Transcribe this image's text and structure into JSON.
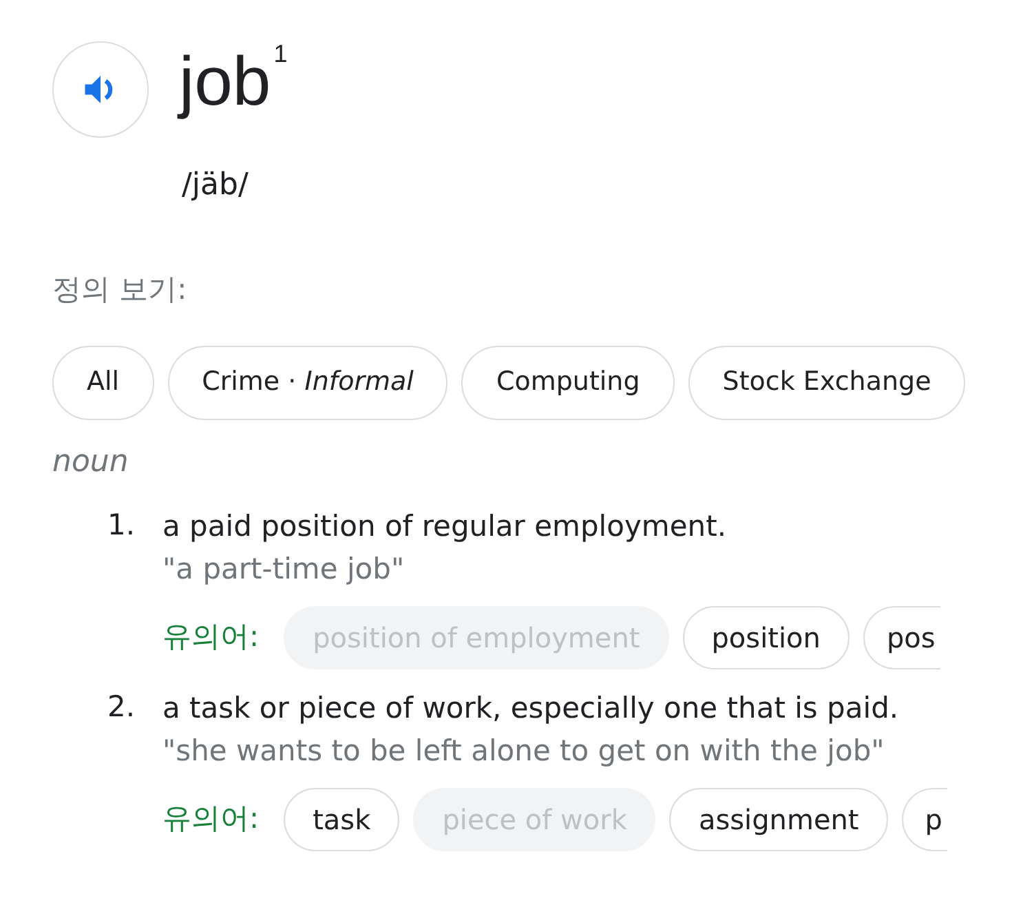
{
  "headword": {
    "word": "job",
    "superscript": "1",
    "pronunciation": "/jäb/"
  },
  "filters": {
    "label": "정의 보기:",
    "items": [
      {
        "text": "All"
      },
      {
        "text": "Crime · *Informal*"
      },
      {
        "text": "Computing"
      },
      {
        "text": "Stock Exchange"
      }
    ]
  },
  "part_of_speech": "noun",
  "senses": [
    {
      "number": "1.",
      "definition": "a paid position of regular employment.",
      "example": "\"a part-time job\"",
      "synonyms_label": "유의어:",
      "synonyms": [
        {
          "text": "position of employment",
          "linked": false,
          "cut": false
        },
        {
          "text": "position",
          "linked": true,
          "cut": false
        },
        {
          "text": "pos",
          "linked": true,
          "cut": true
        }
      ]
    },
    {
      "number": "2.",
      "definition": "a task or piece of work, especially one that is paid.",
      "example": "\"she wants to be left alone to get on with the job\"",
      "synonyms_label": "유의어:",
      "synonyms": [
        {
          "text": "task",
          "linked": true,
          "cut": false
        },
        {
          "text": "piece of work",
          "linked": false,
          "cut": false
        },
        {
          "text": "assignment",
          "linked": true,
          "cut": false
        },
        {
          "text": "p",
          "linked": true,
          "cut": true
        }
      ]
    }
  ]
}
